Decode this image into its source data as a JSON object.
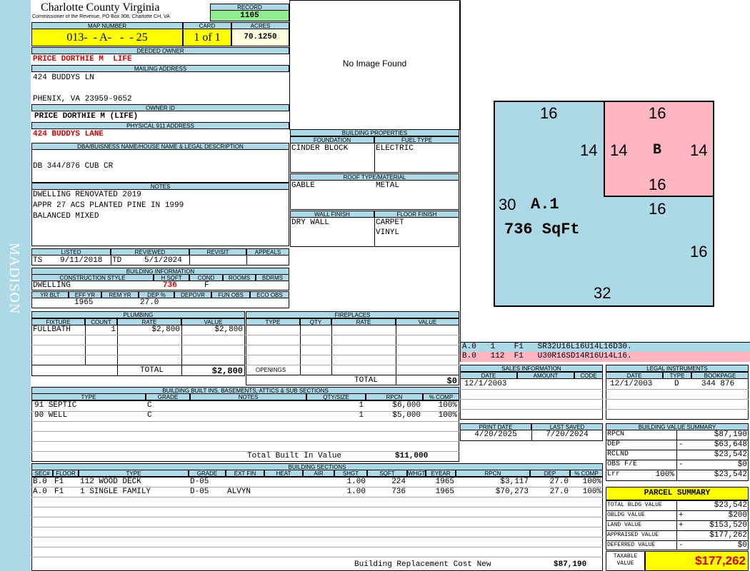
{
  "side_label": "MADISON",
  "header": {
    "title": "Charlotte County Virginia",
    "subtitle": "Commissioner of the Revenue, PO Box 308, Charlotte CH, VA",
    "record_label": "RECORD",
    "record_value": "1105",
    "map_label": "MAP NUMBER",
    "map_value": "013-  - A-   -  - 25",
    "card_label": "CARD",
    "card_value": "1 of 1",
    "acres_label": "ACRES",
    "acres_value": "70.1250"
  },
  "owner": {
    "deeded_label": "DEEDED OWNER",
    "deeded_value": "PRICE DORTHIE M  LIFE",
    "mailing_label": "MAILING ADDRESS",
    "mailing_line1": "424 BUDDYS LN",
    "mailing_line2": "",
    "mailing_line3": "PHENIX, VA 23959-9652",
    "owner_id_label": "OWNER ID",
    "owner_id_value": "PRICE DORTHIE M (LIFE)",
    "address911_label": "PHYSICAL 911 ADDRESS",
    "address911_value": "424 BUDDYS LANE"
  },
  "legal": {
    "label": "DBA/BUISNESS NAME/HOUSE NAME & LEGAL DESCRIPTION",
    "value": "DB 344/876 CUB CR"
  },
  "notes": {
    "label": "NOTES",
    "lines": [
      "DWELLING RENOVATED 2019",
      "APPR 27 ACS PLANTED PINE IN 1999",
      "BALANCED MIXED"
    ]
  },
  "dates": {
    "listed_label": "LISTED",
    "listed_by": "TS",
    "listed_date": "9/11/2018",
    "reviewed_label": "REVIEWED",
    "reviewed_by": "TD",
    "reviewed_date": "5/1/2024",
    "revisit_label": "REVISIT",
    "appeals_label": "APPEALS"
  },
  "building_info": {
    "label": "BUILDING INFORMATION",
    "h_construction": "CONSTRUCTION STYLE",
    "h_hsqft": "H SQFT",
    "h_cond": "COND",
    "h_rooms": "ROOMS",
    "h_bdrms": "BDRMS",
    "construction": "DWELLING",
    "hsqft": "736",
    "cond": "F",
    "h_yrblt": "YR BLT",
    "h_effyr": "EFF YR",
    "h_remyr": "REM YR",
    "h_dep": "DEP %",
    "h_depovr": "DEPOVR",
    "h_funobs": "FUN OBS",
    "h_ecoobs": "ECO OBS",
    "effyr": "1965",
    "dep": "27.0"
  },
  "image_panel": {
    "text": "No Image Found"
  },
  "building_props": {
    "label": "BUILDING PROPERTIES",
    "foundation_label": "FOUNDATION",
    "fuel_label": "FUEL TYPE",
    "foundation": "CINDER BLOCK",
    "fuel": "ELECTRIC",
    "roof_label": "ROOF TYPE/MATERIAL",
    "roof_type": "GABLE",
    "roof_material": "METAL",
    "wall_label": "WALL FINISH",
    "floor_label": "FLOOR FINISH",
    "wall": "DRY WALL",
    "floor1": "CARPET",
    "floor2": "VINYL"
  },
  "sketch": {
    "dims": [
      "16",
      "16",
      "14",
      "14",
      "14",
      "B",
      "16",
      "30",
      "A.1",
      "16",
      "736 SqFt",
      "16",
      "32"
    ],
    "colors": {
      "a": "#add8e6",
      "b": "#ffb6c1"
    },
    "code_a": "A.0   1    F1   SR32U16L16U14L16D30.",
    "code_b": "B.0   112  F1   U30R16SD14R16U14L16."
  },
  "plumbing": {
    "label": "PLUMBING",
    "headers": [
      "FIXTURE",
      "COUNT",
      "RATE",
      "VALUE"
    ],
    "rows": [
      [
        "FULLBATH",
        "1",
        "$2,800",
        "$2,800"
      ]
    ],
    "total_label": "TOTAL",
    "total": "$2,800"
  },
  "fireplaces": {
    "label": "FIREPLACES",
    "headers": [
      "TYPE",
      "QTY",
      "RATE",
      "VALUE"
    ],
    "openings_label": "OPENINGS",
    "total_label": "TOTAL",
    "total": "$0"
  },
  "sales": {
    "label": "SALES INFORMATION",
    "headers": [
      "DATE",
      "AMOUNT",
      "CODE"
    ],
    "rows": [
      [
        "12/1/2003",
        "",
        ""
      ]
    ]
  },
  "legal_instruments": {
    "label": "LEGAL INSTRUMENTS",
    "headers": [
      "DATE",
      "TYPE",
      "BOOKPAGE"
    ],
    "rows": [
      [
        "12/1/2003",
        "D",
        "344 876"
      ]
    ]
  },
  "print": {
    "print_label": "PRINT DATE",
    "print_date": "4/20/2025",
    "saved_label": "LAST SAVED",
    "saved_date": "7/20/2024"
  },
  "value_summary": {
    "label": "BUILDING VALUE SUMMARY",
    "rows": [
      {
        "k": "RPCN",
        "op": "",
        "v": "$87,190"
      },
      {
        "k": "DEP",
        "op": "-",
        "v": "$63,648"
      },
      {
        "k": "RCLND",
        "op": "",
        "v": "$23,542"
      },
      {
        "k": "OBS F/E",
        "op": "-",
        "v": "$0"
      },
      {
        "k": "Lrr",
        "pct": "100%",
        "v": "$23,542"
      }
    ]
  },
  "parcel_summary": {
    "title": "PARCEL SUMMARY",
    "rows": [
      {
        "k": "TOTAL BLDG VALUE",
        "op": "",
        "v": "$23,542"
      },
      {
        "k": "OBLDG VALUE",
        "op": "+",
        "v": "$200"
      },
      {
        "k": "LAND VALUE",
        "op": "+",
        "v": "$153,520"
      },
      {
        "k": "APPRAISED VALUE",
        "op": "",
        "v": "$177,262"
      },
      {
        "k": "DEFERRED VALUE",
        "op": "-",
        "v": "$0"
      }
    ],
    "taxable_label1": "TAXABLE",
    "taxable_label2": "VALUE",
    "taxable_value": "$177,262"
  },
  "builtins": {
    "label": "BUILDING BUILT INS, BASEMENTS, ATTICS & SUB SECTIONS",
    "headers": [
      "TYPE",
      "GRADE",
      "NOTES",
      "QTY/SIZE",
      "RPCN",
      "% COMP"
    ],
    "rows": [
      [
        "91 SEPTIC",
        "C",
        "",
        "1",
        "$6,000",
        "100%"
      ],
      [
        "90 WELL",
        "C",
        "",
        "1",
        "$5,000",
        "100%"
      ]
    ],
    "total_label": "Total Built In Value",
    "total": "$11,000"
  },
  "sections": {
    "label": "BUILDING SECTIONS",
    "headers": [
      "SEC#",
      "FLOOR",
      "TYPE",
      "GRADE",
      "EXT FIN",
      "HEAT",
      "AIR",
      "SHGT",
      "SQFT",
      "WHGT",
      "EYEAR",
      "RPCN",
      "DEP",
      "% COMP"
    ],
    "rows": [
      [
        "B.0",
        "F1",
        "112 WOOD DECK",
        "D-05",
        "",
        "",
        "",
        "1.00",
        "224",
        "",
        "1965",
        "$3,117",
        "27.0",
        "100%"
      ],
      [
        "A.0",
        "F1",
        "1 SINGLE FAMILY",
        "D-05",
        "ALVYN",
        "",
        "",
        "1.00",
        "736",
        "",
        "1965",
        "$70,273",
        "27.0",
        "100%"
      ]
    ],
    "footer_label": "Building Replacement Cost New",
    "footer_value": "$87,190"
  }
}
